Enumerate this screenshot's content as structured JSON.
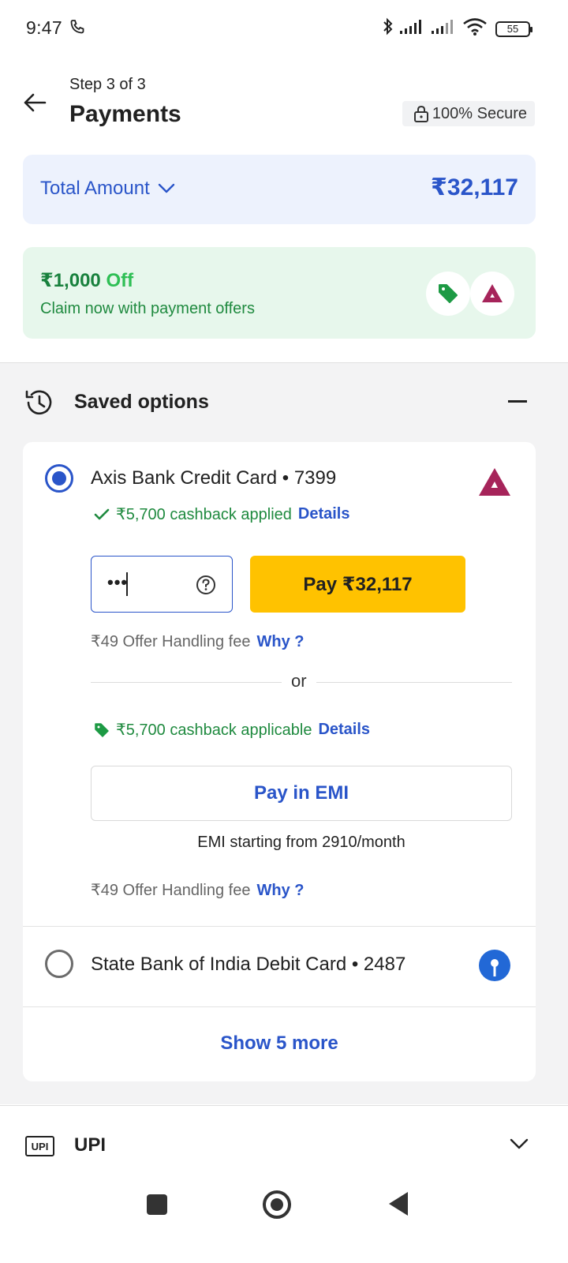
{
  "status_bar": {
    "time": "9:47",
    "battery": "55"
  },
  "header": {
    "step": "Step 3 of 3",
    "title": "Payments",
    "secure_label": "100% Secure"
  },
  "total": {
    "label": "Total Amount",
    "amount": "₹32,117"
  },
  "offer": {
    "amount": "₹1,000",
    "off": "Off",
    "subtitle": "Claim now with payment offers"
  },
  "saved_options": {
    "title": "Saved options",
    "cards": [
      {
        "name": "Axis Bank Credit Card • 7399",
        "selected": true,
        "cashback_applied": "₹5,700 cashback applied",
        "details": "Details",
        "cvv_value": "•••",
        "pay_button": "Pay ₹32,117",
        "fee": "₹49 Offer Handling fee",
        "why": "Why ?",
        "or": "or",
        "cashback_applicable": "₹5,700 cashback applicable",
        "emi_button": "Pay in EMI",
        "emi_sub": "EMI starting from 2910/month",
        "fee2": "₹49 Offer Handling fee",
        "why2": "Why ?"
      },
      {
        "name": "State Bank of India Debit Card • 2487",
        "selected": false
      }
    ],
    "show_more": "Show 5 more"
  },
  "upi": {
    "badge": "UPI",
    "label": "UPI"
  },
  "colors": {
    "accent": "#2a55c9",
    "pay_button": "#ffc200",
    "offer_green": "#1f8a3f",
    "axis": "#a6245a"
  }
}
